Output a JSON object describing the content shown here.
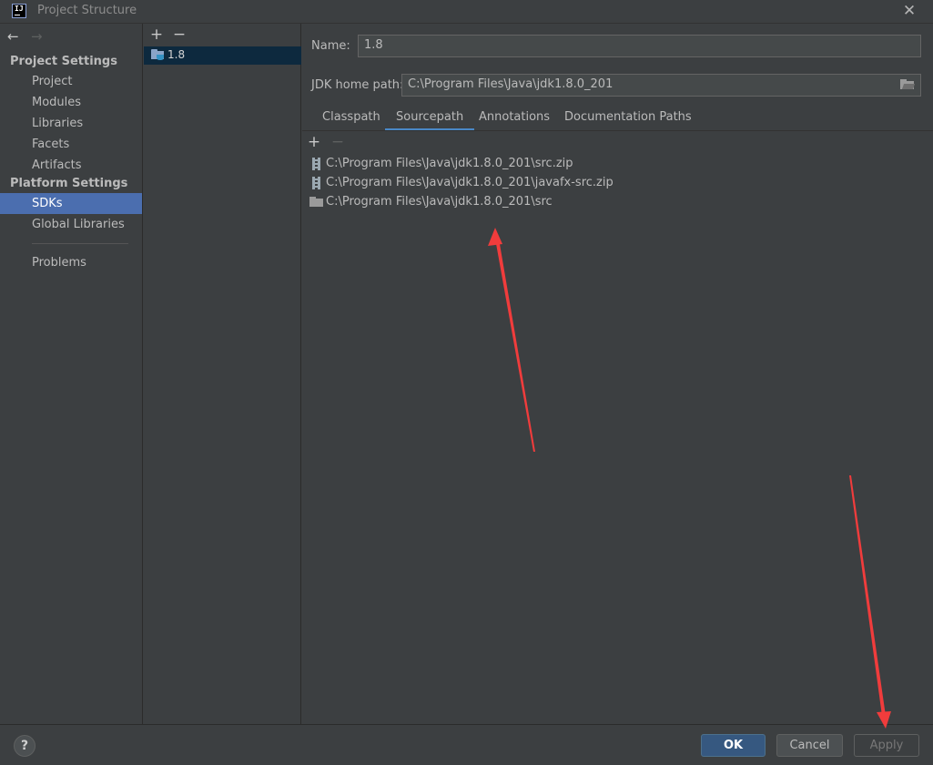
{
  "window": {
    "title": "Project Structure",
    "logo_text": "IJ",
    "close_glyph": "✕"
  },
  "nav": {
    "back_glyph": "←",
    "forward_glyph": "→"
  },
  "sidebar": {
    "project_settings_heading": "Project Settings",
    "platform_settings_heading": "Platform Settings",
    "project_items": [
      "Project",
      "Modules",
      "Libraries",
      "Facets",
      "Artifacts"
    ],
    "platform_items": [
      "SDKs",
      "Global Libraries"
    ],
    "problems": "Problems",
    "selected": "SDKs"
  },
  "sdk_list": {
    "add_glyph": "+",
    "remove_glyph": "−",
    "items": [
      "1.8"
    ]
  },
  "details": {
    "name_label": "Name:",
    "name_value": "1.8",
    "jdk_home_label": "JDK home path:",
    "jdk_home_value": "C:\\Program Files\\Java\\jdk1.8.0_201",
    "tabs": [
      "Classpath",
      "Sourcepath",
      "Annotations",
      "Documentation Paths"
    ],
    "active_tab": "Sourcepath",
    "tree_add_glyph": "+",
    "tree_remove_glyph": "−",
    "paths": [
      {
        "type": "zip",
        "path": "C:\\Program Files\\Java\\jdk1.8.0_201\\src.zip"
      },
      {
        "type": "zip",
        "path": "C:\\Program Files\\Java\\jdk1.8.0_201\\javafx-src.zip"
      },
      {
        "type": "folder",
        "path": "C:\\Program Files\\Java\\jdk1.8.0_201\\src"
      }
    ]
  },
  "buttons": {
    "help": "?",
    "ok": "OK",
    "cancel": "Cancel",
    "apply": "Apply"
  },
  "colors": {
    "selection": "#4b6eaf",
    "annotation_arrow": "#f03c3c"
  }
}
